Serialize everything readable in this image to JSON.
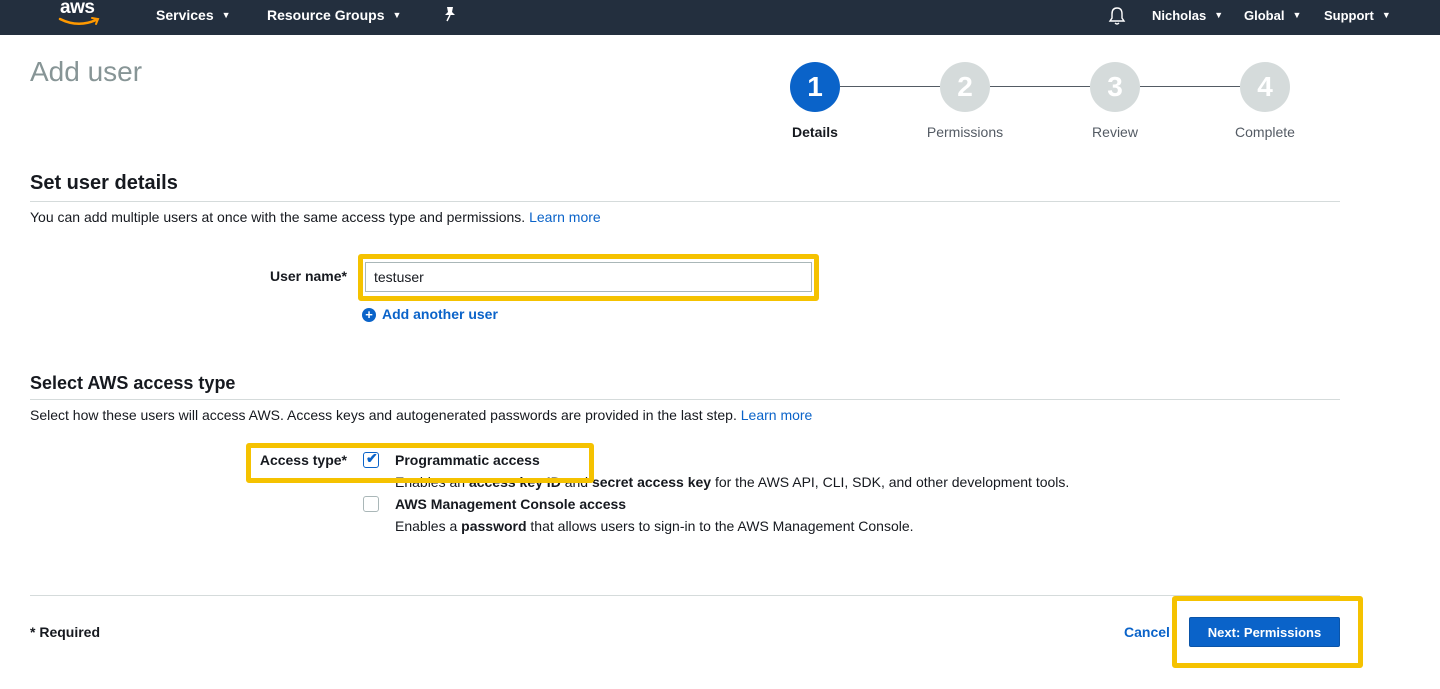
{
  "topnav": {
    "logo": "aws",
    "services": "Services",
    "resource_groups": "Resource Groups",
    "pin_icon": "pin-icon",
    "bell_icon": "bell-icon",
    "user": "Nicholas",
    "region": "Global",
    "support": "Support"
  },
  "page": {
    "title": "Add user"
  },
  "wizard": {
    "steps": [
      {
        "number": "1",
        "label": "Details",
        "active": true
      },
      {
        "number": "2",
        "label": "Permissions",
        "active": false
      },
      {
        "number": "3",
        "label": "Review",
        "active": false
      },
      {
        "number": "4",
        "label": "Complete",
        "active": false
      }
    ]
  },
  "user_details": {
    "title": "Set user details",
    "description": "You can add multiple users at once with the same access type and permissions.",
    "learn_more": "Learn more",
    "username_label": "User name*",
    "username_value": "testuser",
    "add_another": "Add another user"
  },
  "access_type": {
    "title": "Select AWS access type",
    "description": "Select how these users will access AWS. Access keys and autogenerated passwords are provided in the last step.",
    "learn_more": "Learn more",
    "label": "Access type*",
    "options": [
      {
        "title": "Programmatic access",
        "checked": true,
        "desc_pre": "Enables an ",
        "desc_b1": "access key ID",
        "desc_mid": " and ",
        "desc_b2": "secret access key",
        "desc_post": " for the AWS API, CLI, SDK, and other development tools."
      },
      {
        "title": "AWS Management Console access",
        "checked": false,
        "desc_pre": "Enables a ",
        "desc_b1": "password",
        "desc_post": " that allows users to sign-in to the AWS Management Console."
      }
    ]
  },
  "footer": {
    "required": "* Required",
    "cancel": "Cancel",
    "next": "Next: Permissions"
  },
  "colors": {
    "nav_bg": "#232f3e",
    "accent": "#0a63c9",
    "highlight": "#f5c200",
    "step_inactive": "#d5dbdb"
  }
}
